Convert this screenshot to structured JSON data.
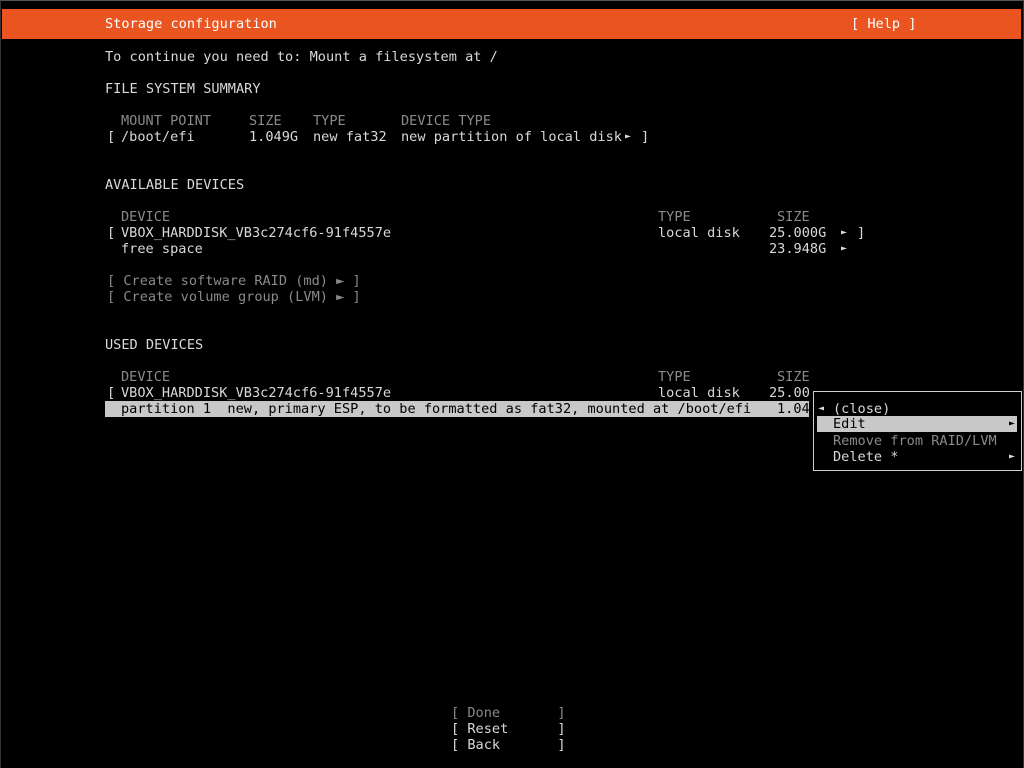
{
  "header": {
    "title": "Storage configuration",
    "help": "[ Help ]"
  },
  "instruction": "To continue you need to: Mount a filesystem at /",
  "fs_summary": {
    "heading": "FILE SYSTEM SUMMARY",
    "columns": {
      "mount_point": "MOUNT POINT",
      "size": "SIZE",
      "type": "TYPE",
      "device_type": "DEVICE TYPE"
    },
    "rows": [
      {
        "open": "[",
        "mount_point": "/boot/efi",
        "size": "1.049G",
        "type": "new fat32",
        "device_type": "new partition of local disk",
        "arrow": "►",
        "close": "]"
      }
    ]
  },
  "available": {
    "heading": "AVAILABLE DEVICES",
    "columns": {
      "device": "DEVICE",
      "type": "TYPE",
      "size": "SIZE"
    },
    "disk": {
      "open": "[",
      "name": "VBOX_HARDDISK_VB3c274cf6-91f4557e",
      "type": "local disk",
      "size": "25.000G",
      "arrow": "►",
      "close": "]"
    },
    "free": {
      "name": "free space",
      "size": "23.948G",
      "arrow": "►"
    },
    "actions": [
      "[ Create software RAID (md) ► ]",
      "[ Create volume group (LVM) ► ]"
    ]
  },
  "used": {
    "heading": "USED DEVICES",
    "columns": {
      "device": "DEVICE",
      "type": "TYPE",
      "size": "SIZE"
    },
    "disk": {
      "open": "[",
      "name": "VBOX_HARDDISK_VB3c274cf6-91f4557e",
      "type": "local disk",
      "size": "25.00"
    },
    "partition": {
      "text": "partition 1  new, primary ESP, to be formatted as fat32, mounted at /boot/efi",
      "size": "1.04"
    }
  },
  "context_menu": {
    "close": "(close)",
    "close_arrow": "◄",
    "items": [
      {
        "label": "Edit",
        "arrow": "►"
      },
      {
        "label": "Remove from RAID/LVM"
      },
      {
        "label": "Delete *",
        "arrow": "►"
      }
    ]
  },
  "buttons": {
    "done": "[ Done       ]",
    "reset": "[ Reset      ]",
    "back": "[ Back       ]"
  }
}
